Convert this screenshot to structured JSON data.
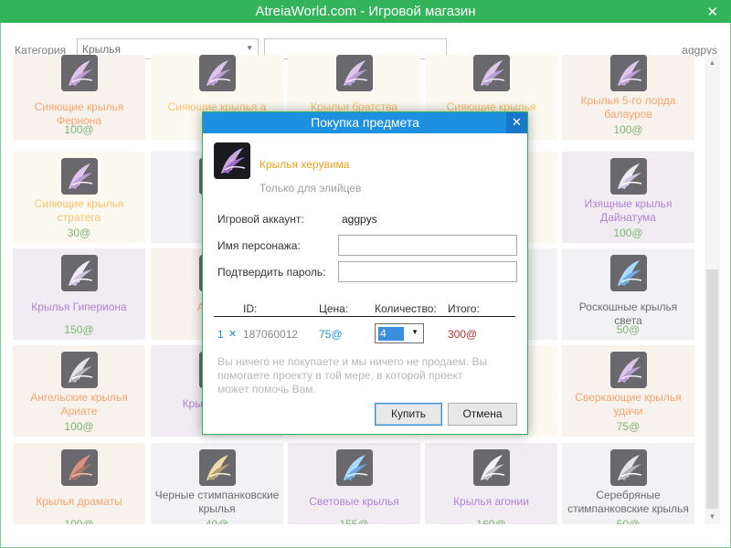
{
  "window": {
    "title": "AtreiaWorld.com - Игровой магазин",
    "close_glyph": "✕"
  },
  "toolbar": {
    "category_label": "Категория",
    "category_value": "Крылья",
    "search_value": "",
    "username": "aggpys"
  },
  "colors": {
    "titlebar": "#33b45a",
    "dialog_title": "#1e90e0",
    "name_orange": "#f0761e",
    "name_purple": "#8a3fc2",
    "name_black": "#1a1a1a",
    "name_yellow": "#f0a020",
    "price_green": "#3a8a2a"
  },
  "shop": {
    "cards": [
      {
        "name": "Сияющие крылья Фернона",
        "price": "100@",
        "color": "orange",
        "bg": "#f5ebe4",
        "icon": "wing-purple-icon"
      },
      {
        "name": "Сияющие крылья а",
        "price": "",
        "color": "yellow",
        "bg": "#fbf6ea",
        "icon": "wing-purple-icon"
      },
      {
        "name": "Крылья братства",
        "price": "",
        "color": "yellow",
        "bg": "#fbf6ea",
        "icon": "wing-purple-icon"
      },
      {
        "name": "Сияющие крылья",
        "price": "",
        "color": "yellow",
        "bg": "#fbf6ea",
        "icon": "wing-purple-icon"
      },
      {
        "name": "Крылья 5-го лорда балауров",
        "price": "100@",
        "color": "orange",
        "bg": "#f5ebe4",
        "icon": "wing-purple-icon"
      },
      {
        "name": "Сияющие крылья стратега",
        "price": "30@",
        "color": "yellow",
        "bg": "#fbf6ea",
        "icon": "wing-purple-icon"
      },
      {
        "name": "Крыл",
        "price": "",
        "color": "black",
        "bg": "#ececf0",
        "icon": "wing-dark-icon"
      },
      {
        "name": "",
        "price": "",
        "color": "black",
        "bg": "#fbf6ea",
        "icon": ""
      },
      {
        "name": "а",
        "price": "",
        "color": "yellow",
        "bg": "#fbf6ea",
        "icon": ""
      },
      {
        "name": "Изящные крылья Дайнатума",
        "price": "100@",
        "color": "purple",
        "bg": "#e8e2ea",
        "icon": "wing-pale-icon"
      },
      {
        "name": "Крылья Гипериона",
        "price": "150@",
        "color": "purple",
        "bg": "#e8e2ea",
        "icon": "wing-pale-icon"
      },
      {
        "name": "Ангел А",
        "price": "",
        "color": "orange",
        "bg": "#f5ebe4",
        "icon": "wing-dark-icon"
      },
      {
        "name": "",
        "price": "",
        "color": "black",
        "bg": "#fbf6ea",
        "icon": ""
      },
      {
        "name": "вета",
        "price": "",
        "color": "black",
        "bg": "#ececf0",
        "icon": ""
      },
      {
        "name": "Роскошные крылья света",
        "price": "50@",
        "color": "black",
        "bg": "#ececf0",
        "icon": "wing-blue-icon"
      },
      {
        "name": "Ангельские крылья Ариате",
        "price": "100@",
        "color": "orange",
        "bg": "#f5ebe4",
        "icon": "wing-silver-icon"
      },
      {
        "name": "Крылья л Три",
        "price": "",
        "color": "purple",
        "bg": "#e8e2ea",
        "icon": "wing-blue-icon"
      },
      {
        "name": "",
        "price": "",
        "color": "black",
        "bg": "#fbf6ea",
        "icon": ""
      },
      {
        "name": "",
        "price": "",
        "color": "black",
        "bg": "#fbf6ea",
        "icon": ""
      },
      {
        "name": "Сверкающие крылья удачи",
        "price": "75@",
        "color": "orange",
        "bg": "#f5ebe4",
        "icon": "wing-purple-icon"
      },
      {
        "name": "Крылья драматы",
        "price": "100@",
        "color": "orange",
        "bg": "#f5ebe4",
        "icon": "wing-red-icon"
      },
      {
        "name": "Черные стимпанковские крылья",
        "price": "40@",
        "color": "black",
        "bg": "#ececf0",
        "icon": "wing-gold-icon"
      },
      {
        "name": "Световые крылья",
        "price": "155@",
        "color": "purple",
        "bg": "#e8e2ea",
        "icon": "wing-blue-icon"
      },
      {
        "name": "Крылья агонии",
        "price": "160@",
        "color": "purple",
        "bg": "#e8e2ea",
        "icon": "wing-white-icon"
      },
      {
        "name": "Серебряные стимпанковские крылья",
        "price": "50@",
        "color": "black",
        "bg": "#ececf0",
        "icon": "wing-silver-icon"
      }
    ]
  },
  "dialog": {
    "title": "Покупка предмета",
    "close_glyph": "✕",
    "item_name": "Крылья херувима",
    "item_note": "Только для элийцев",
    "account_label": "Игровой аккаунт:",
    "account_value": "aggpys",
    "character_label": "Имя персонажа:",
    "character_value": "",
    "password_label": "Подтвердить пароль:",
    "password_value": "",
    "col_id": "ID:",
    "col_price": "Цена:",
    "col_qty": "Количество:",
    "col_total": "Итого:",
    "row_count": "1",
    "row_remove": "✕",
    "row_id": "187060012",
    "row_price": "75@",
    "row_qty": "4",
    "row_total": "300@",
    "note": "Вы ничего не покупаете и мы ничего не продаем. Вы помогаете проекту в той мере, в которой проект может помочь Вам.",
    "buy_label": "Купить",
    "cancel_label": "Отмена"
  }
}
